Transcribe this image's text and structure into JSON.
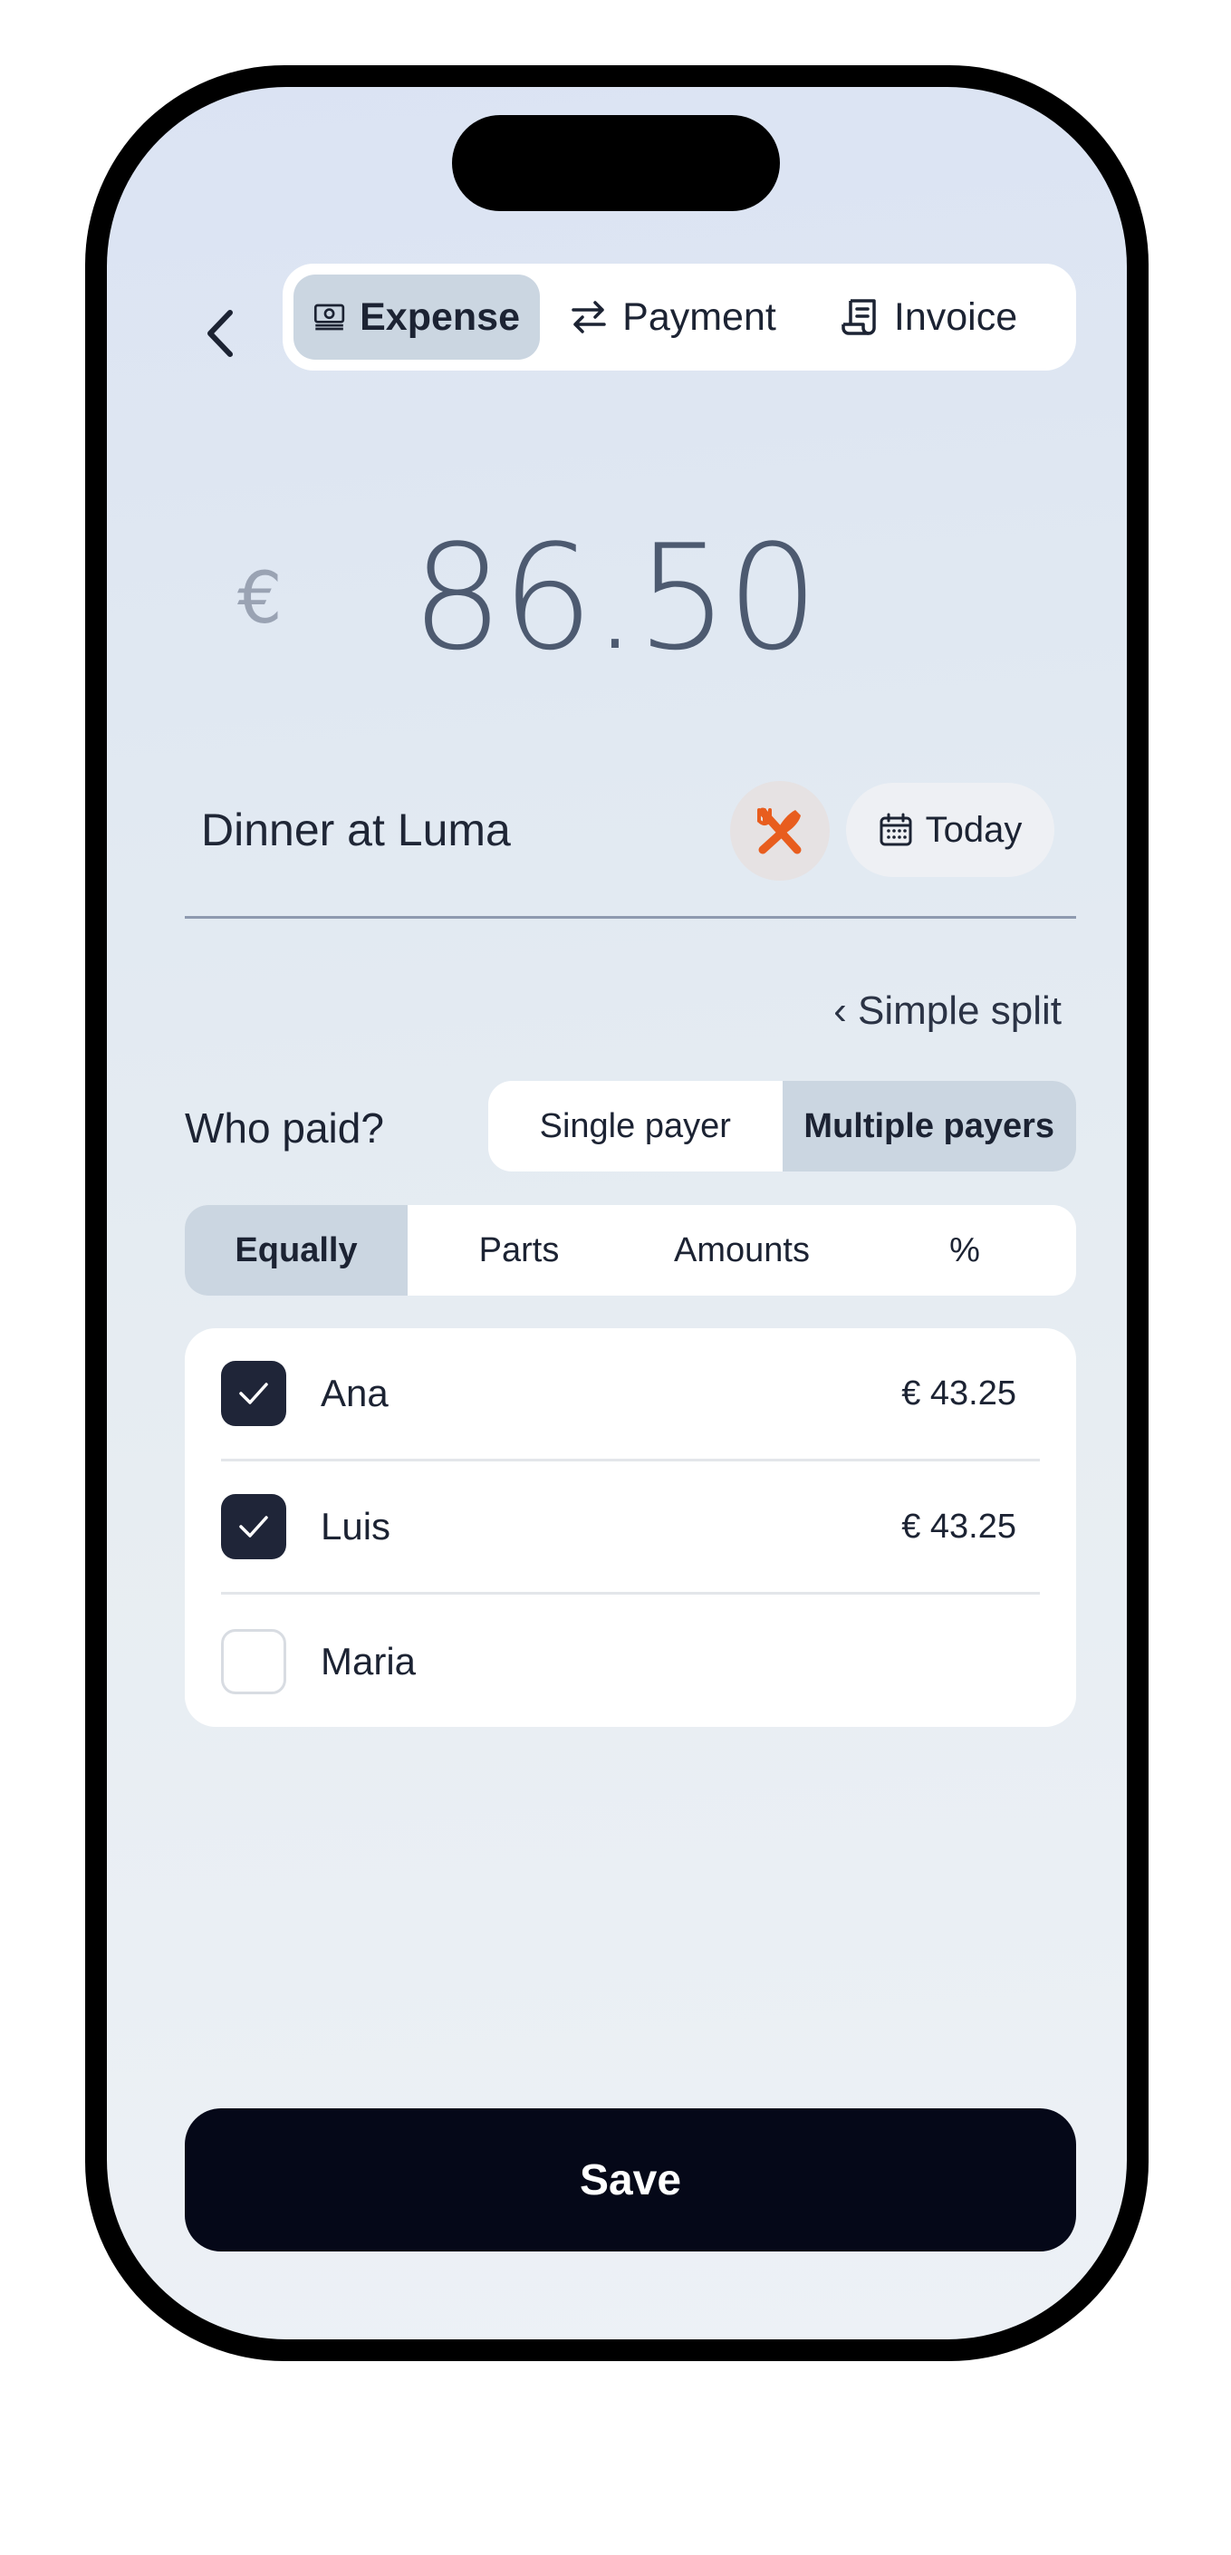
{
  "header": {
    "tabs": [
      {
        "label": "Expense",
        "icon": "banknote-icon",
        "active": true
      },
      {
        "label": "Payment",
        "icon": "transfer-arrows-icon",
        "active": false
      },
      {
        "label": "Invoice",
        "icon": "receipt-icon",
        "active": false
      }
    ]
  },
  "amount": {
    "currency_symbol": "€",
    "value": "86.50"
  },
  "description": {
    "value": "Dinner at Luma",
    "category_icon": "fork-knife-icon",
    "category_color": "#e85d1e",
    "date_label": "Today"
  },
  "split_mode_link": "‹ Simple split",
  "who_paid": {
    "label": "Who paid?",
    "options": [
      {
        "label": "Single payer",
        "active": false
      },
      {
        "label": "Multiple payers",
        "active": true
      }
    ]
  },
  "split_method": {
    "options": [
      {
        "label": "Equally",
        "active": true
      },
      {
        "label": "Parts",
        "active": false
      },
      {
        "label": "Amounts",
        "active": false
      },
      {
        "label": "%",
        "active": false
      }
    ]
  },
  "participants": [
    {
      "name": "Ana",
      "checked": true,
      "amount": "€ 43.25"
    },
    {
      "name": "Luis",
      "checked": true,
      "amount": "€ 43.25"
    },
    {
      "name": "Maria",
      "checked": false,
      "amount": ""
    }
  ],
  "save_label": "Save",
  "colors": {
    "accent_dark": "#050818",
    "segment_active": "#cbd6e1",
    "checkbox_on": "#1f2538"
  }
}
